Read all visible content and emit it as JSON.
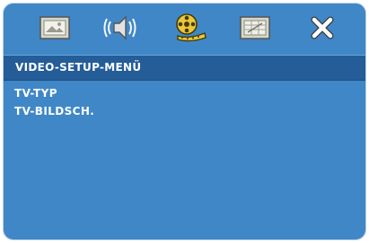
{
  "toolbar": {
    "icons": [
      {
        "name": "general-setup-icon",
        "selected": false
      },
      {
        "name": "audio-setup-icon",
        "selected": false
      },
      {
        "name": "video-setup-icon",
        "selected": true
      },
      {
        "name": "preference-setup-icon",
        "selected": false
      },
      {
        "name": "exit-icon",
        "selected": false
      }
    ]
  },
  "menu": {
    "title": "VIDEO-SETUP-MENÜ",
    "items": [
      {
        "label": "TV-TYP"
      },
      {
        "label": "TV-BILDSCH."
      }
    ]
  },
  "colors": {
    "background": "#3f87c7",
    "title_bar": "#245d97",
    "text": "#ffffff"
  }
}
